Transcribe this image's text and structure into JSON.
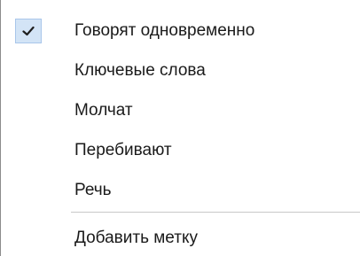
{
  "menu": {
    "items": [
      {
        "label": "Говорят одновременно",
        "checked": true
      },
      {
        "label": "Ключевые слова",
        "checked": false
      },
      {
        "label": "Молчат",
        "checked": false
      },
      {
        "label": "Перебивают",
        "checked": false
      },
      {
        "label": "Речь",
        "checked": false
      }
    ],
    "footer_item": {
      "label": "Добавить метку"
    },
    "colors": {
      "check_highlight": "#d3e4f6",
      "check_border": "#a9c6ea",
      "separator": "#c8c8c8"
    }
  }
}
